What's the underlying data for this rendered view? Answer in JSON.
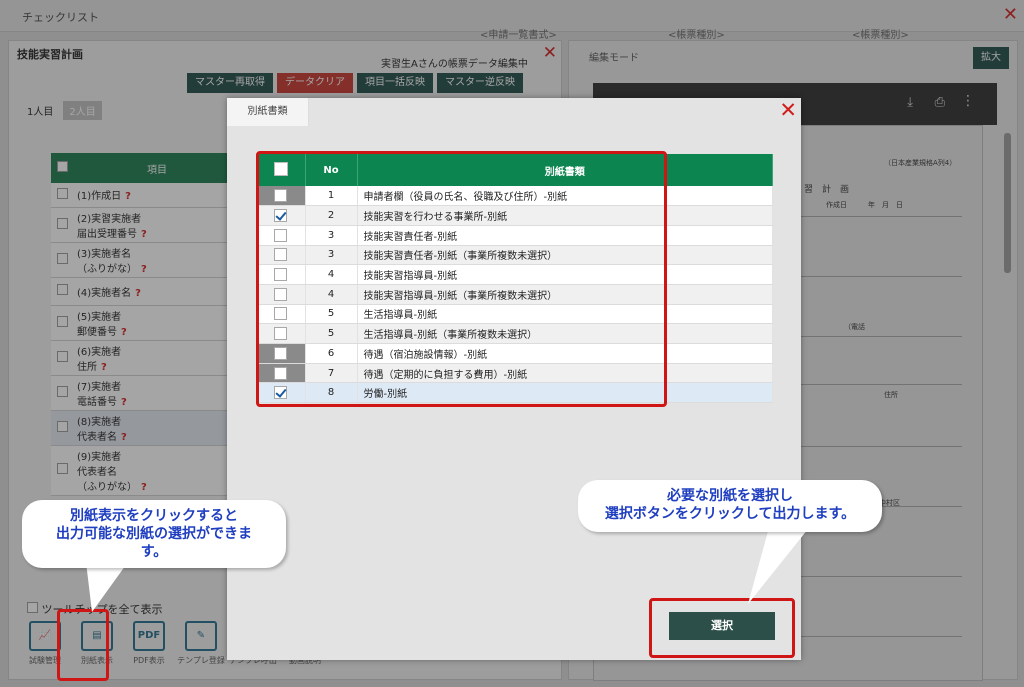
{
  "app": {
    "title": "チェックリスト",
    "top_links": [
      "<申請一覧書式>",
      "<帳票種別>",
      "<帳票種別>"
    ]
  },
  "left_panel": {
    "title": "技能実習計画",
    "subtitle": "実習生Aさんの帳票データ編集中",
    "buttons": {
      "master_reload": "マスター再取得",
      "data_clear": "データクリア",
      "bulk_apply": "項目一括反映",
      "master_reverse": "マスター逆反映"
    },
    "tabs": [
      "1人目",
      "2人目"
    ],
    "table_header": "項目",
    "items": [
      [
        "(1)作成日"
      ],
      [
        "(2)実習実施者",
        "届出受理番号"
      ],
      [
        "(3)実施者名",
        "（ふりがな）"
      ],
      [
        "(4)実施者名"
      ],
      [
        "(5)実施者",
        "郵便番号"
      ],
      [
        "(6)実施者",
        "住所"
      ],
      [
        "(7)実施者",
        "電話番号"
      ],
      [
        "(8)実施者",
        "代表者名"
      ],
      [
        "(9)実施者",
        "代表者名",
        "（ふりがな）"
      ]
    ],
    "tooltip_toggle": "ツールチップを全て表示",
    "toolbar": {
      "trial": "試験管理",
      "attachment": "別紙表示",
      "pdf": "PDF表示",
      "pdf_icon_text": "PDF",
      "template_register": "テンプレ登録",
      "template_call": "テンプレ呼出",
      "video": "動画説明"
    }
  },
  "right_panel": {
    "mode": "編集モード",
    "zoom": "拡大",
    "doc_form_no": "（日本産業規格A列4）",
    "doc_heading": "習　計　画",
    "doc_date": "作成日　　　年　月　日",
    "doc_phone": "（電話",
    "doc_address_label": "住所",
    "doc_address_value": "愛知県名古屋市中村区"
  },
  "modal": {
    "tab": "別紙書類",
    "header": {
      "no": "No",
      "name": "別紙書類"
    },
    "rows": [
      {
        "no": "1",
        "name": "申請者欄（役員の氏名、役職及び住所）-別紙",
        "checked": false,
        "disabled": true
      },
      {
        "no": "2",
        "name": "技能実習を行わせる事業所-別紙",
        "checked": true,
        "disabled": false
      },
      {
        "no": "3",
        "name": "技能実習責任者-別紙",
        "checked": false,
        "disabled": false
      },
      {
        "no": "3",
        "name": "技能実習責任者-別紙（事業所複数未選択）",
        "checked": false,
        "disabled": false
      },
      {
        "no": "4",
        "name": "技能実習指導員-別紙",
        "checked": false,
        "disabled": false
      },
      {
        "no": "4",
        "name": "技能実習指導員-別紙（事業所複数未選択）",
        "checked": false,
        "disabled": false
      },
      {
        "no": "5",
        "name": "生活指導員-別紙",
        "checked": false,
        "disabled": false
      },
      {
        "no": "5",
        "name": "生活指導員-別紙（事業所複数未選択）",
        "checked": false,
        "disabled": false
      },
      {
        "no": "6",
        "name": "待遇（宿泊施設情報）-別紙",
        "checked": false,
        "disabled": true
      },
      {
        "no": "7",
        "name": "待遇（定期的に負担する費用）-別紙",
        "checked": false,
        "disabled": true
      },
      {
        "no": "8",
        "name": "労働-別紙",
        "checked": true,
        "disabled": false
      }
    ],
    "select_button": "選択"
  },
  "callouts": {
    "left": [
      "別紙表示をクリックすると",
      "出力可能な別紙の選択ができま",
      "す。"
    ],
    "right": [
      "必要な別紙を選択し",
      "選択ボタンをクリックして出力します。"
    ]
  },
  "colors": {
    "table_header": "#0d8550",
    "highlight": "#d01515",
    "callout_text": "#1f3fc0",
    "button_dark": "#2d4f4a",
    "button_red": "#c8352d"
  }
}
